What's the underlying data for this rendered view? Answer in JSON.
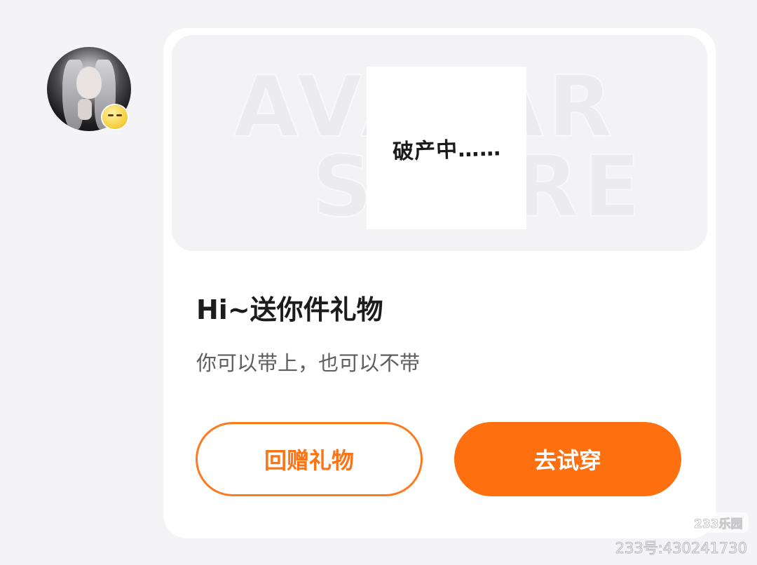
{
  "sender": {
    "avatar": "user-avatar",
    "badge_icon": "smiley-emoji-icon"
  },
  "gift_card": {
    "banner": {
      "watermark_line1": "AVATAR",
      "watermark_line2": "STORE",
      "image_text": "破产中……"
    },
    "title": "Hi~送你件礼物",
    "subtitle": "你可以带上，也可以不带",
    "return_gift_label": "回赠礼物",
    "try_on_label": "去试穿",
    "colors": {
      "accent": "#fe6f0f",
      "card_bg": "#ffffff",
      "page_bg": "#f4f4f6"
    }
  },
  "watermark": {
    "site_badge": "233乐园",
    "site_id": "233号:430241730"
  }
}
